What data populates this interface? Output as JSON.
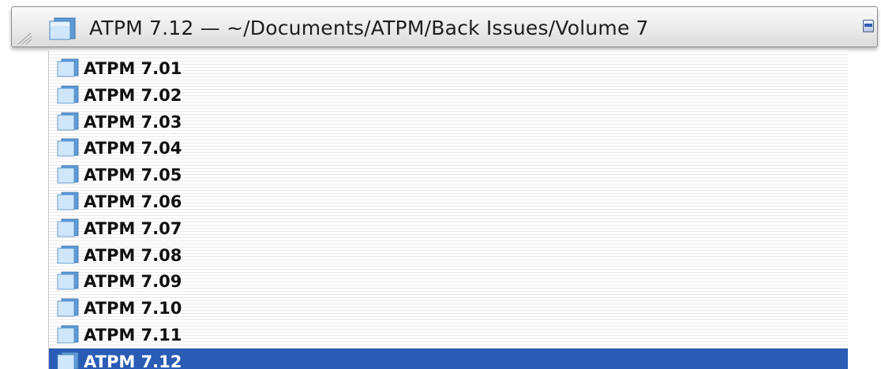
{
  "window": {
    "title": "ATPM 7.12  —  ~/Documents/ATPM/Back Issues/Volume 7"
  },
  "colors": {
    "selection": "#2a5cb5",
    "folder_light": "#cfe6fb",
    "folder_dark": "#5d9bd8"
  },
  "file_list": {
    "items": [
      {
        "label": "ATPM 7.01",
        "icon": "folder-icon",
        "selected": false
      },
      {
        "label": "ATPM 7.02",
        "icon": "folder-icon",
        "selected": false
      },
      {
        "label": "ATPM 7.03",
        "icon": "folder-icon",
        "selected": false
      },
      {
        "label": "ATPM 7.04",
        "icon": "folder-icon",
        "selected": false
      },
      {
        "label": "ATPM 7.05",
        "icon": "folder-icon",
        "selected": false
      },
      {
        "label": "ATPM 7.06",
        "icon": "folder-icon",
        "selected": false
      },
      {
        "label": "ATPM 7.07",
        "icon": "folder-icon",
        "selected": false
      },
      {
        "label": "ATPM 7.08",
        "icon": "folder-icon",
        "selected": false
      },
      {
        "label": "ATPM 7.09",
        "icon": "folder-icon",
        "selected": false
      },
      {
        "label": "ATPM 7.10",
        "icon": "folder-icon",
        "selected": false
      },
      {
        "label": "ATPM 7.11",
        "icon": "folder-icon",
        "selected": false
      },
      {
        "label": "ATPM 7.12",
        "icon": "folder-icon",
        "selected": true
      }
    ]
  }
}
